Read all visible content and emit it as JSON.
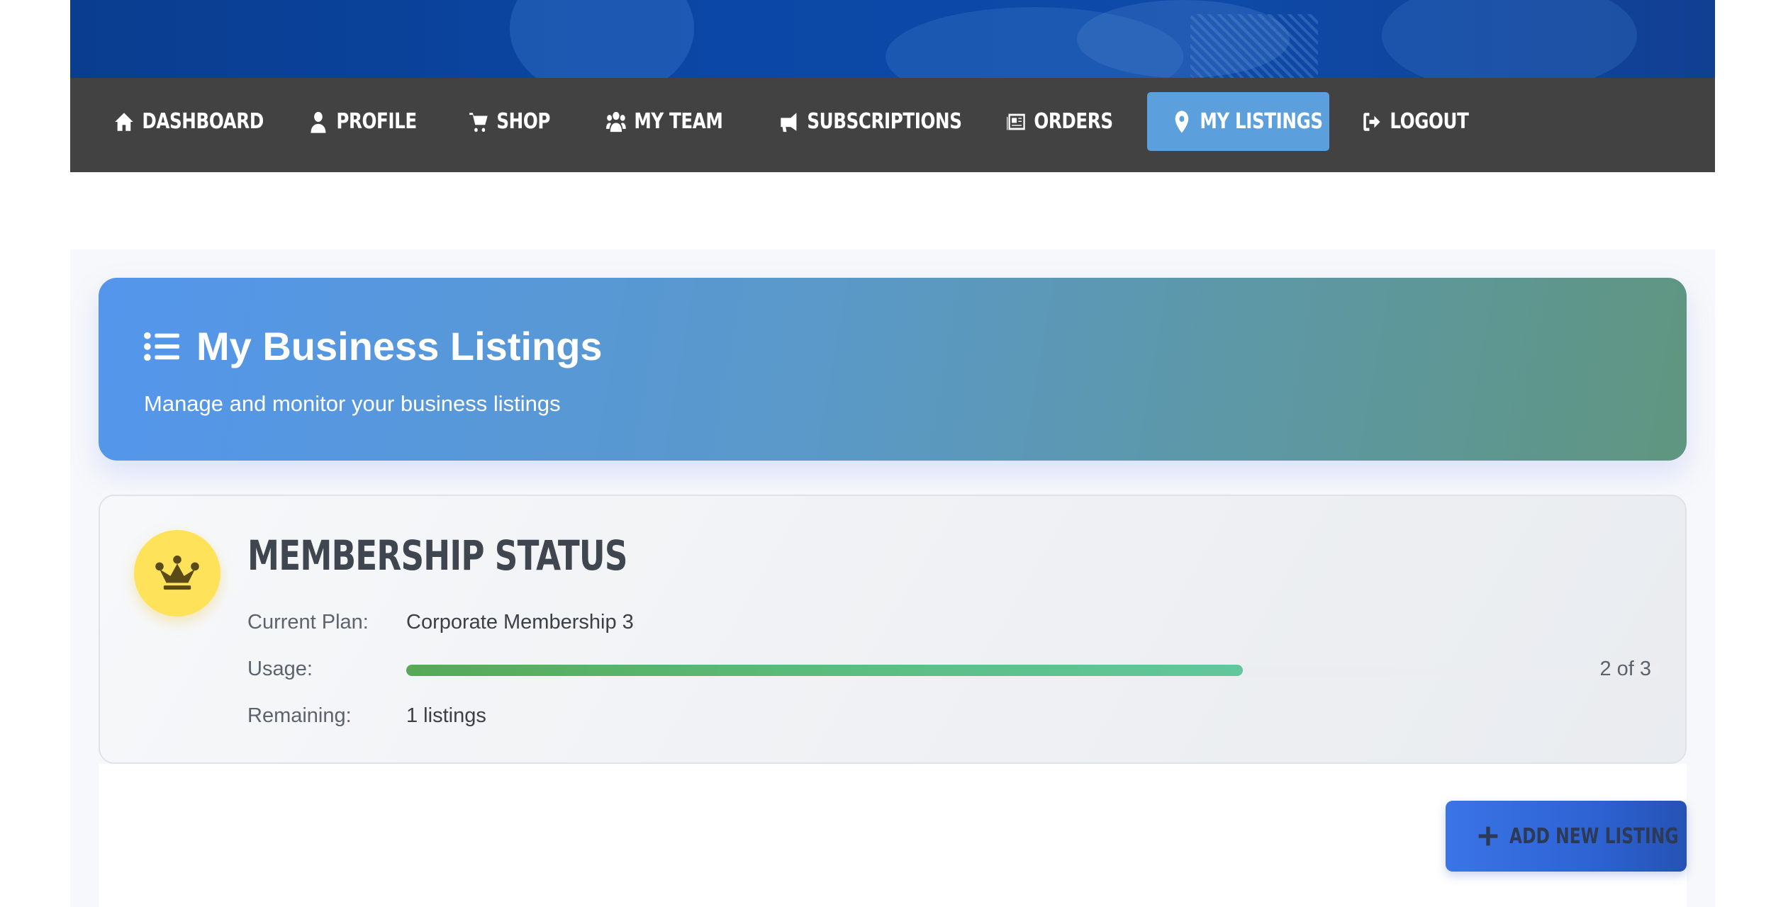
{
  "nav": {
    "items": [
      {
        "label": "DASHBOARD",
        "icon": "home-icon"
      },
      {
        "label": "PROFILE",
        "icon": "user-icon"
      },
      {
        "label": "SHOP",
        "icon": "cart-icon"
      },
      {
        "label": "MY TEAM",
        "icon": "users-icon"
      },
      {
        "label": "SUBSCRIPTIONS",
        "icon": "megaphone-icon"
      },
      {
        "label": "ORDERS",
        "icon": "newspaper-icon"
      },
      {
        "label": "MY LISTINGS",
        "icon": "map-pin-icon",
        "active": true
      },
      {
        "label": "LOGOUT",
        "icon": "sign-out-icon"
      }
    ],
    "active_color": "#5ba0dc",
    "bar_color": "#424242"
  },
  "header": {
    "title": "My Business Listings",
    "subtitle": "Manage and monitor your business listings",
    "icon": "list-icon"
  },
  "membership": {
    "title": "MEMBERSHIP STATUS",
    "icon": "crown-icon",
    "current_plan_label": "Current Plan:",
    "current_plan_value": "Corporate Membership 3",
    "usage_label": "Usage:",
    "usage_used": 2,
    "usage_total": 3,
    "usage_text": "2 of 3",
    "remaining_label": "Remaining:",
    "remaining_value": "1 listings"
  },
  "actions": {
    "add_listing_label": "ADD NEW LISTING",
    "add_listing_icon": "plus-icon"
  }
}
